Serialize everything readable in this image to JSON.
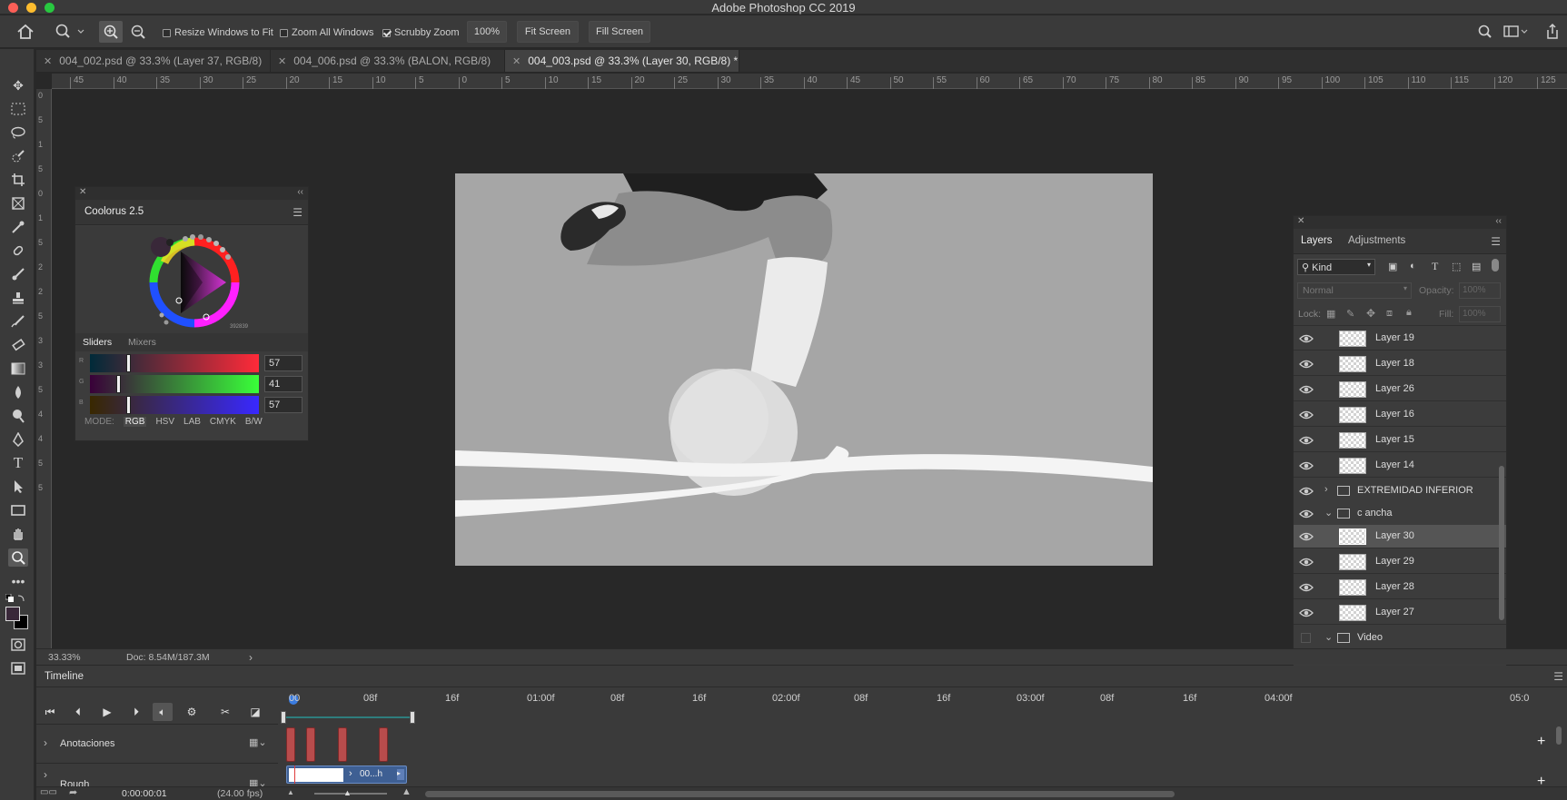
{
  "window": {
    "title": "Adobe Photoshop CC 2019"
  },
  "options": {
    "resize_windows": "Resize Windows to Fit",
    "zoom_all": "Zoom All Windows",
    "scrubby_zoom": "Scrubby Zoom",
    "zoom_value": "100%",
    "fit_screen": "Fit Screen",
    "fill_screen": "Fill Screen"
  },
  "tabs": [
    {
      "label": "004_002.psd @ 33.3% (Layer 37, RGB/8)"
    },
    {
      "label": "004_006.psd @ 33.3% (BALON, RGB/8)"
    },
    {
      "label": "004_003.psd @ 33.3% (Layer 30, RGB/8) *"
    }
  ],
  "ruler_h": [
    "45",
    "40",
    "35",
    "30",
    "25",
    "20",
    "15",
    "10",
    "5",
    "0",
    "5",
    "10",
    "15",
    "20",
    "25",
    "30",
    "35",
    "40",
    "45",
    "50",
    "55",
    "60",
    "65",
    "70",
    "75",
    "80",
    "85",
    "90",
    "95",
    "100",
    "105",
    "110",
    "115",
    "120",
    "125"
  ],
  "ruler_v": [
    "0",
    "5",
    "1",
    "5",
    "0",
    "1",
    "5",
    "2",
    "2",
    "5",
    "3",
    "3",
    "5",
    "4",
    "4",
    "5",
    "5"
  ],
  "coloruspanel": {
    "title": "Coolorus 2.5",
    "hex": "392839",
    "tab_sliders": "Sliders",
    "tab_mixers": "Mixers",
    "r": {
      "label": "R",
      "value": "57"
    },
    "g": {
      "label": "G",
      "value": "41"
    },
    "b": {
      "label": "B",
      "value": "57"
    },
    "mode_label": "MODE:",
    "modes": [
      "RGB",
      "HSV",
      "LAB",
      "CMYK",
      "B/W"
    ]
  },
  "layers": {
    "tab_layers": "Layers",
    "tab_adjustments": "Adjustments",
    "kind": "Kind",
    "blend": "Normal",
    "opacity_label": "Opacity:",
    "opacity_value": "100%",
    "lock_label": "Lock:",
    "fill_label": "Fill:",
    "fill_value": "100%",
    "rows": [
      {
        "name": "Layer 19"
      },
      {
        "name": "Layer 18"
      },
      {
        "name": "Layer 26"
      },
      {
        "name": "Layer 16"
      },
      {
        "name": "Layer 15"
      },
      {
        "name": "Layer 14"
      },
      {
        "name": "EXTREMIDAD INFERIOR"
      },
      {
        "name": "c ancha"
      },
      {
        "name": "Layer 30"
      },
      {
        "name": "Layer 29"
      },
      {
        "name": "Layer 28"
      },
      {
        "name": "Layer 27"
      },
      {
        "name": "Video"
      }
    ]
  },
  "status": {
    "zoom": "33.33%",
    "doc": "Doc: 8.54M/187.3M"
  },
  "timeline": {
    "title": "Timeline",
    "ticks": [
      "00",
      "08f",
      "16f",
      "01:00f",
      "08f",
      "16f",
      "02:00f",
      "08f",
      "16f",
      "03:00f",
      "08f",
      "16f",
      "04:00f",
      "05:0"
    ],
    "track1": "Anotaciones",
    "track2": "Rough",
    "clip_label": "00...h",
    "time": "0:00:00:01",
    "fps": "(24.00 fps)"
  }
}
